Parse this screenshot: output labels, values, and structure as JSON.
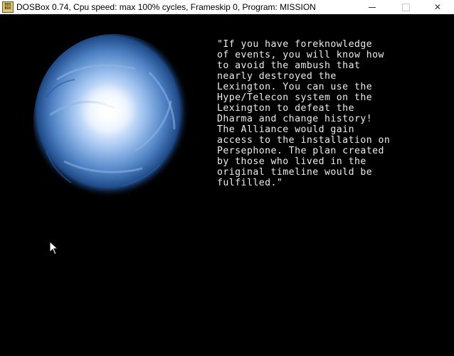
{
  "window": {
    "icon": "dosbox-icon",
    "title": "DOSBox 0.74, Cpu speed: max 100% cycles, Frameskip  0, Program:  MISSION",
    "controls": {
      "minimize": "minimize-icon",
      "maximize": "maximize-icon",
      "close": "✕"
    }
  },
  "scene": {
    "background_color": "#000000",
    "orb_colors": [
      "#ffffff",
      "#cfe3ff",
      "#6f9fd8",
      "#2a5a9c",
      "#0a2046"
    ],
    "cursor_icon": "arrow-cursor-icon",
    "story_text": "\"If you have foreknowledge\nof events, you will know how\nto avoid the ambush that\nnearly destroyed the\nLexington. You can use the\nHype/Telecon system on the\nLexington to defeat the\nDharma and change history!\nThe Alliance would gain\naccess to the installation on\nPersephone. The plan created\nby those who lived in the\noriginal timeline would be\nfulfilled.\""
  }
}
